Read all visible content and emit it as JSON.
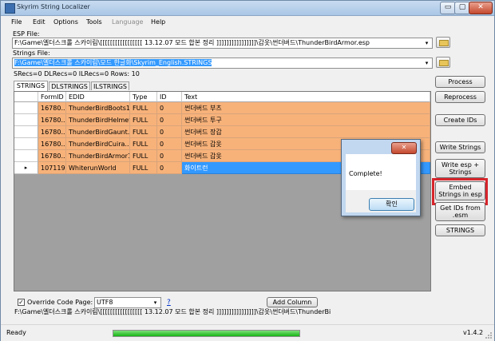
{
  "window": {
    "title": "Skyrim String Localizer"
  },
  "titlebar_buttons": {
    "minimize": "▭",
    "maximize": "▢",
    "close": "✕"
  },
  "menu": [
    "File",
    "Edit",
    "Options",
    "Tools",
    "Language",
    "Help"
  ],
  "esp_file": {
    "label": "ESP File:",
    "value": "F:\\Game\\엘더스크롤 스카이림\\[[[[[[[[[[[[[[[[[ 13.12.07 모드 합본 정리 ]]]]]]]]]]]]]]]]\\갑옷\\썬더버드\\ThunderBirdArmor.esp"
  },
  "strings_file": {
    "label": "Strings File:",
    "value": "F:\\Game\\엘더스크롤 스카이림\\모드 한글화\\Skyrim_English.STRINGS"
  },
  "stats": "SRecs=0  DLRecs=0  ILRecs=0   Rows: 10",
  "tabs": [
    "STRINGS",
    "DLSTRINGS",
    "ILSTRINGS"
  ],
  "grid": {
    "columns": [
      "FormID",
      "EDID",
      "Type",
      "ID",
      "Text"
    ],
    "rows": [
      {
        "formid": "16780...",
        "edid": "ThunderBirdBoots1",
        "type": "FULL",
        "id": "0",
        "text": "썬더버드 부츠"
      },
      {
        "formid": "16780...",
        "edid": "ThunderBirdHelmet1",
        "type": "FULL",
        "id": "0",
        "text": "썬더버드 투구"
      },
      {
        "formid": "16780...",
        "edid": "ThunderBirdGaunt...",
        "type": "FULL",
        "id": "0",
        "text": "썬더버드 장갑"
      },
      {
        "formid": "16780...",
        "edid": "ThunderBirdCuira...",
        "type": "FULL",
        "id": "0",
        "text": "썬더버드 갑옷"
      },
      {
        "formid": "16780...",
        "edid": "ThunderBirdArmor1",
        "type": "FULL",
        "id": "0",
        "text": "썬더버드 갑옷"
      },
      {
        "formid": "107119",
        "edid": "WhiterunWorld",
        "type": "FULL",
        "id": "0",
        "text": "화이트런",
        "current": true
      }
    ]
  },
  "right_buttons": {
    "process": "Process",
    "reprocess": "Reprocess",
    "create_ids": "Create IDs",
    "write_strings": "Write Strings",
    "write_esp_strings_1": "Write esp +",
    "write_esp_strings_2": "Strings",
    "embed_1": "Embed",
    "embed_2": "Strings in esp",
    "get_ids_1": "Get IDs from",
    "get_ids_2": ".esm",
    "strings": "STRINGS"
  },
  "dialog": {
    "message": "Complete!",
    "ok": "확인",
    "close": "✕"
  },
  "override": {
    "label": "Override Code Page:",
    "checked": "✓",
    "code_page": "UTF8",
    "help": "?"
  },
  "add_column": "Add Column",
  "bottom_path": "F:\\Game\\엘더스크롤 스카이림\\[[[[[[[[[[[[[[[[[ 13.12.07 모드 합본 정리 ]]]]]]]]]]]]]]]]\\갑옷\\썬더버드\\ThunderBi",
  "status": {
    "text": "Ready",
    "progress": 1.0,
    "version": "v1.4.2"
  },
  "icons": {
    "folder": "folder-icon",
    "row_pointer": "▸",
    "dropdown": "▾"
  }
}
